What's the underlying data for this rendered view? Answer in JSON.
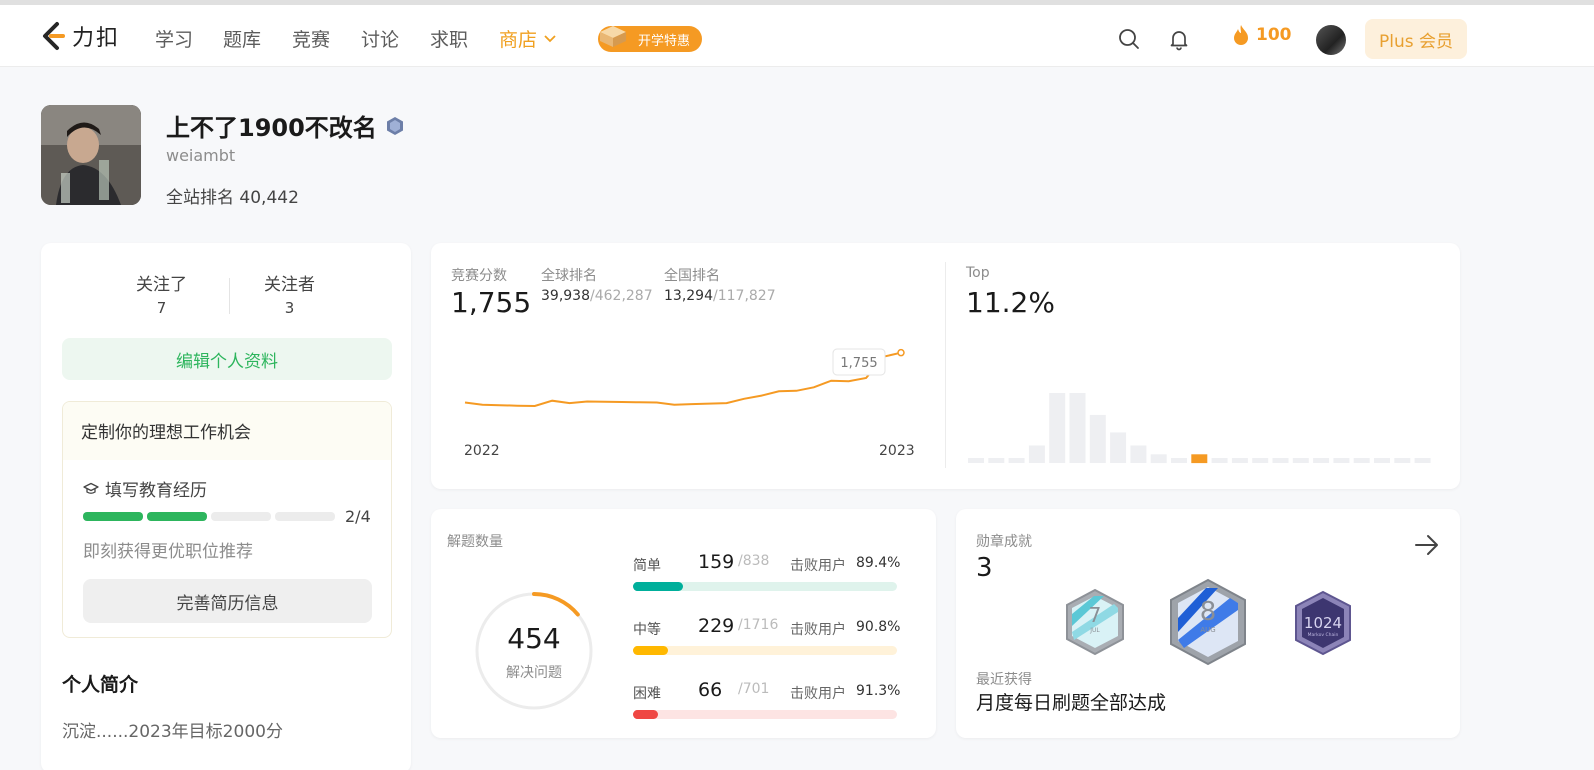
{
  "nav": {
    "logo_text": "力扣",
    "items": [
      "学习",
      "题库",
      "竞赛",
      "讨论",
      "求职"
    ],
    "store": "商店",
    "promo": "开学特惠",
    "streak": "100",
    "plus": "Plus 会员"
  },
  "profile": {
    "name": "上不了1900不改名",
    "handle": "weiambt",
    "rank_label": "全站排名",
    "rank_value": "40,442"
  },
  "sidebar": {
    "following_label": "关注了",
    "following_count": "7",
    "followers_label": "关注者",
    "followers_count": "3",
    "edit_button": "编辑个人资料",
    "job_title": "定制你的理想工作机会",
    "job_edu": "填写教育经历",
    "job_progress": "2/4",
    "job_progress_fraction": 0.5,
    "job_tip": "即刻获得更优职位推荐",
    "job_button": "完善简历信息",
    "bio_title": "个人简介",
    "bio_text": "沉淀......2023年目标2000分"
  },
  "contest": {
    "score_label": "竞赛分数",
    "score": "1,755",
    "global_label": "全球排名",
    "global_rank": "39,938",
    "global_total": "/462,287",
    "national_label": "全国排名",
    "national_rank": "13,294",
    "national_total": "/117,827",
    "tooltip": "1,755",
    "year_start": "2022",
    "year_end": "2023",
    "top_label": "Top",
    "top_value": "11.2%",
    "accent": "#f59a23"
  },
  "chart_data": [
    {
      "type": "line",
      "series": [
        {
          "values": [
            1568,
            1560,
            1558,
            1556,
            1555,
            1575,
            1566,
            1572,
            1571,
            1570,
            1569,
            1568,
            1560,
            1562,
            1564,
            1566,
            1582,
            1594,
            1610,
            1612,
            1625,
            1650,
            1648,
            1660,
            1740,
            1755
          ]
        }
      ],
      "x_labels": [
        "2022",
        "2023"
      ],
      "annotation": "1,755"
    },
    {
      "type": "bar",
      "values": [
        1,
        1,
        1,
        4,
        16,
        16,
        11,
        7,
        4,
        2,
        1,
        2,
        1,
        1,
        1,
        1,
        1,
        1,
        1,
        1,
        1,
        1,
        1
      ],
      "highlight_index": 11
    }
  ],
  "solved": {
    "label": "解题数量",
    "total": "454",
    "total_label": "解决问题",
    "beat_label": "击败用户",
    "rows": [
      {
        "name": "简单",
        "count": "159",
        "total": "/838",
        "beat": "89.4%",
        "fraction": 0.19,
        "color": "#00af9b",
        "track": "#dff3ec"
      },
      {
        "name": "中等",
        "count": "229",
        "total": "/1716",
        "beat": "90.8%",
        "fraction": 0.133,
        "color": "#ffb800",
        "track": "#fff2d9"
      },
      {
        "name": "困难",
        "count": "66",
        "total": "/701",
        "beat": "91.3%",
        "fraction": 0.094,
        "color": "#ef4743",
        "track": "#fde4e3"
      }
    ]
  },
  "badges": {
    "label": "勋章成就",
    "count": "3",
    "recent_label": "最近获得",
    "recent_name": "月度每日刷题全部达成",
    "items": [
      {
        "num": "7",
        "sub": "JUL"
      },
      {
        "num": "8",
        "sub": "AUG"
      },
      {
        "num": "1024",
        "sub": "Markov Chain"
      }
    ]
  }
}
